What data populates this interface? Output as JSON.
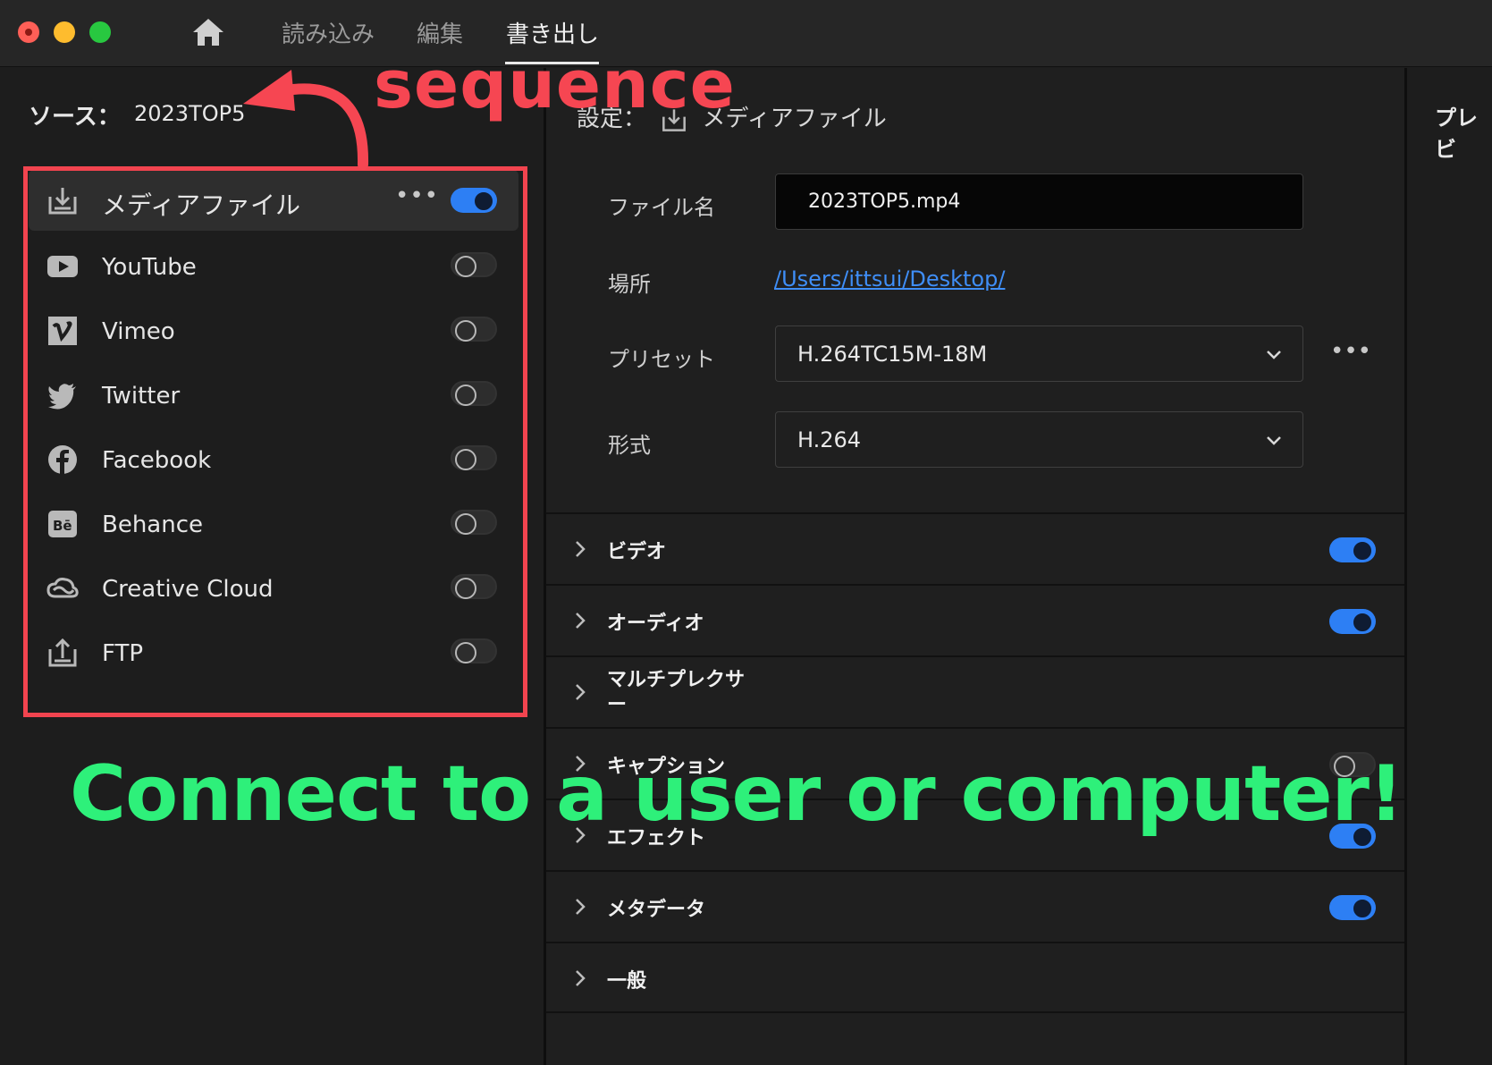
{
  "window": {
    "nav": {
      "import": "読み込み",
      "edit": "編集",
      "export": "書き出し"
    }
  },
  "source": {
    "label": "ソース：",
    "value": "2023TOP5"
  },
  "destinations": [
    {
      "label": "メディアファイル",
      "icon": "media-file-download-icon",
      "enabled": true
    },
    {
      "label": "YouTube",
      "icon": "youtube-icon",
      "enabled": false
    },
    {
      "label": "Vimeo",
      "icon": "vimeo-icon",
      "enabled": false
    },
    {
      "label": "Twitter",
      "icon": "twitter-icon",
      "enabled": false
    },
    {
      "label": "Facebook",
      "icon": "facebook-icon",
      "enabled": false
    },
    {
      "label": "Behance",
      "icon": "behance-icon",
      "enabled": false
    },
    {
      "label": "Creative Cloud",
      "icon": "creative-cloud-icon",
      "enabled": false
    },
    {
      "label": "FTP",
      "icon": "ftp-upload-icon",
      "enabled": false
    }
  ],
  "settings": {
    "title_prefix": "設定：",
    "title": "メディアファイル",
    "filename_label": "ファイル名",
    "filename_value": "2023TOP5.mp4",
    "location_label": "場所",
    "location_value": "/Users/ittsui/Desktop/",
    "preset_label": "プリセット",
    "preset_value": "H.264TC15M-18M",
    "format_label": "形式",
    "format_value": "H.264"
  },
  "sections": [
    {
      "label": "ビデオ",
      "toggle": "on"
    },
    {
      "label": "オーディオ",
      "toggle": "on"
    },
    {
      "label": "マルチプレクサー",
      "toggle": "none"
    },
    {
      "label": "キャプション",
      "toggle": "off"
    },
    {
      "label": "エフェクト",
      "toggle": "on"
    },
    {
      "label": "メタデータ",
      "toggle": "on"
    },
    {
      "label": "一般",
      "toggle": "none"
    }
  ],
  "preview": {
    "title": "プレビ"
  },
  "annotations": {
    "sequence": "sequence",
    "caption": "Connect to a user or computer!"
  },
  "colors": {
    "accent_blue": "#2d7ff4",
    "link_blue": "#3f8ef7",
    "annotation_red": "#f2444f",
    "annotation_green": "#2ef07a"
  }
}
